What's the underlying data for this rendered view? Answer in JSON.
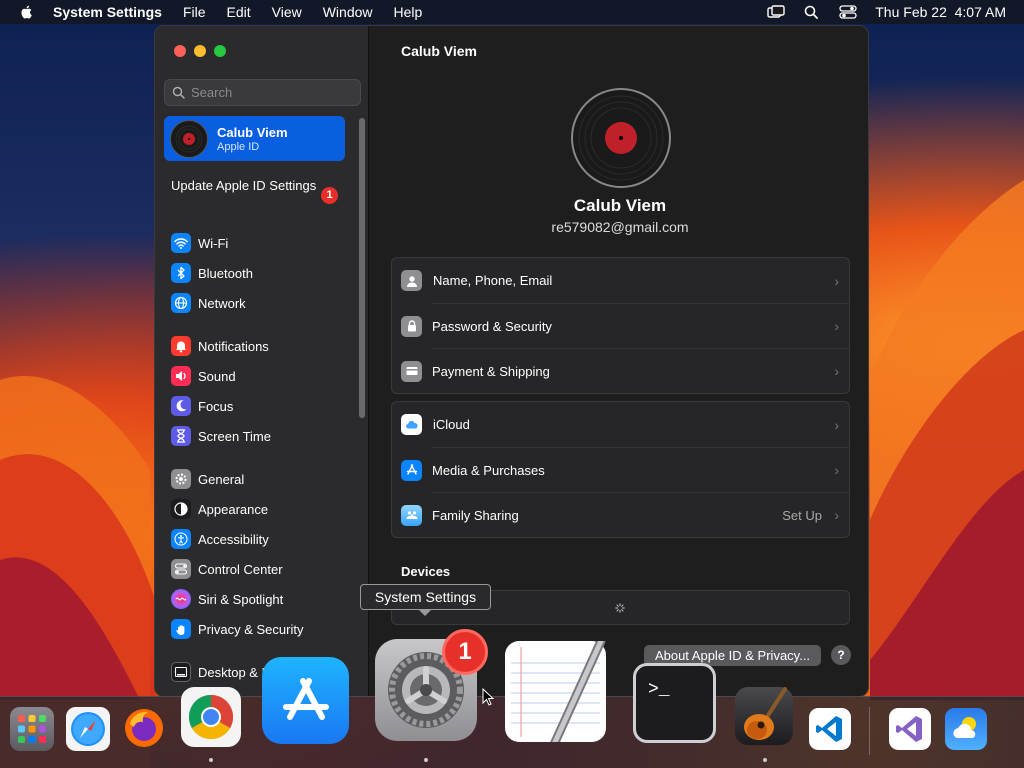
{
  "menubar": {
    "app_name": "System Settings",
    "items": [
      "File",
      "Edit",
      "View",
      "Window",
      "Help"
    ],
    "clock": "Thu Feb 22  4:07 AM"
  },
  "sidebar": {
    "search_placeholder": "Search",
    "account": {
      "name": "Calub Viem",
      "subtitle": "Apple ID"
    },
    "update": {
      "label": "Update Apple ID Settings",
      "badge": "1"
    },
    "groups": [
      [
        {
          "label": "Wi-Fi",
          "icon": "wifi-icon",
          "color": "#0a84ff"
        },
        {
          "label": "Bluetooth",
          "icon": "bluetooth-icon",
          "color": "#0a84ff"
        },
        {
          "label": "Network",
          "icon": "globe-icon",
          "color": "#0a84ff"
        }
      ],
      [
        {
          "label": "Notifications",
          "icon": "bell-icon",
          "color": "#ff3b30"
        },
        {
          "label": "Sound",
          "icon": "speaker-icon",
          "color": "#ff2d55"
        },
        {
          "label": "Focus",
          "icon": "moon-icon",
          "color": "#5e5ce6"
        },
        {
          "label": "Screen Time",
          "icon": "hourglass-icon",
          "color": "#5e5ce6"
        }
      ],
      [
        {
          "label": "General",
          "icon": "gear-icon",
          "color": "#8e8e93"
        },
        {
          "label": "Appearance",
          "icon": "appearance-icon",
          "color": "#1c1c1e"
        },
        {
          "label": "Accessibility",
          "icon": "accessibility-icon",
          "color": "#0a84ff"
        },
        {
          "label": "Control Center",
          "icon": "control-center-icon",
          "color": "#8e8e93"
        },
        {
          "label": "Siri & Spotlight",
          "icon": "siri-icon",
          "color": "#bf5af2"
        },
        {
          "label": "Privacy & Security",
          "icon": "hand-icon",
          "color": "#0a84ff"
        }
      ],
      [
        {
          "label": "Desktop & Dock",
          "icon": "dock-icon",
          "color": "#1c1c1e"
        }
      ]
    ]
  },
  "main": {
    "title": "Calub Viem",
    "profile": {
      "name": "Calub Viem",
      "email": "re579082@gmail.com"
    },
    "group1": [
      {
        "label": "Name, Phone, Email",
        "icon": "person-icon",
        "color": "#8e8e93"
      },
      {
        "label": "Password & Security",
        "icon": "lock-icon",
        "color": "#8e8e93"
      },
      {
        "label": "Payment & Shipping",
        "icon": "creditcard-icon",
        "color": "#8e8e93"
      }
    ],
    "group2": [
      {
        "label": "iCloud",
        "icon": "icloud-icon",
        "color": "#ffffff"
      },
      {
        "label": "Media & Purchases",
        "icon": "appstore-icon",
        "color": "#0a84ff"
      },
      {
        "label": "Family Sharing",
        "icon": "family-icon",
        "color": "#5ac8fa",
        "extra": "Set Up"
      }
    ],
    "devices_label": "Devices",
    "about_button": "About Apple ID & Privacy...",
    "help_button": "?"
  },
  "tooltip": "System Settings",
  "dock": {
    "apps": [
      {
        "name": "Launchpad",
        "icon": "launchpad-icon"
      },
      {
        "name": "Safari",
        "icon": "safari-icon"
      },
      {
        "name": "Firefox",
        "icon": "firefox-icon"
      },
      {
        "name": "Chrome",
        "icon": "chrome-icon"
      },
      {
        "name": "App Store",
        "icon": "appstore-icon"
      },
      {
        "name": "System Settings",
        "icon": "gear-icon",
        "badge": "1"
      },
      {
        "name": "TextEdit",
        "icon": "textedit-icon"
      },
      {
        "name": "Terminal",
        "icon": "terminal-icon"
      },
      {
        "name": "GarageBand",
        "icon": "guitar-icon"
      },
      {
        "name": "Visual Studio Code",
        "icon": "vscode-icon"
      },
      {
        "name": "Visual Studio",
        "icon": "visualstudio-icon"
      },
      {
        "name": "Weather",
        "icon": "weather-icon"
      }
    ]
  }
}
